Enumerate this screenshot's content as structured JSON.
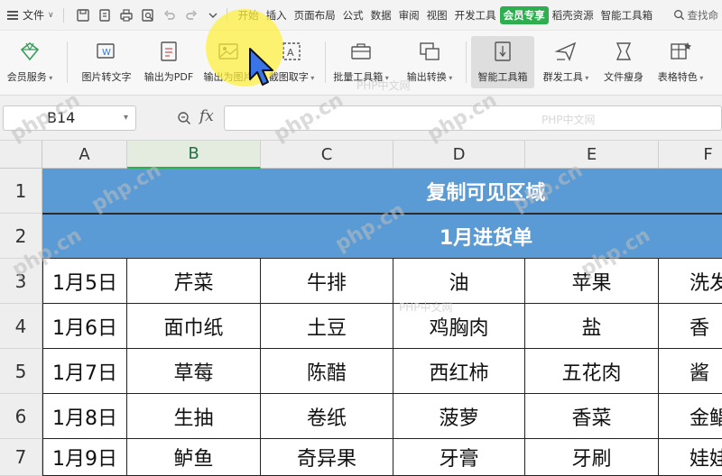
{
  "menubar": {
    "file_label": "文件",
    "tabs": [
      {
        "label": "开始"
      },
      {
        "label": "插入"
      },
      {
        "label": "页面布局"
      },
      {
        "label": "公式"
      },
      {
        "label": "数据"
      },
      {
        "label": "审阅"
      },
      {
        "label": "视图"
      },
      {
        "label": "开发工具"
      },
      {
        "label": "会员专享",
        "active": true
      },
      {
        "label": "稻壳资源"
      },
      {
        "label": "智能工具箱"
      }
    ],
    "search_label": "查找命"
  },
  "ribbon": {
    "buttons": [
      {
        "label": "会员服务",
        "dropdown": true
      },
      {
        "label": "图片转文字"
      },
      {
        "label": "输出为PDF"
      },
      {
        "label": "输出为图片"
      },
      {
        "label": "截图取字",
        "dropdown": true
      },
      {
        "label": "批量工具箱",
        "dropdown": true
      },
      {
        "label": "输出转换",
        "dropdown": true
      },
      {
        "label": "智能工具箱",
        "highlighted": true
      },
      {
        "label": "群发工具",
        "dropdown": true
      },
      {
        "label": "文件瘦身"
      },
      {
        "label": "表格特色",
        "dropdown": true
      }
    ]
  },
  "formula_bar": {
    "cell_ref": "B14",
    "fx_label": "fx",
    "formula": ""
  },
  "sheet": {
    "columns": [
      "A",
      "B",
      "C",
      "D",
      "E",
      "F"
    ],
    "selected_column": "B",
    "rows": [
      "1",
      "2",
      "3",
      "4",
      "5",
      "6",
      "7"
    ],
    "title": "复制可见区域",
    "subtitle": "1月进货单",
    "data": [
      [
        "1月5日",
        "芹菜",
        "牛排",
        "油",
        "苹果",
        "洗发"
      ],
      [
        "1月6日",
        "面巾纸",
        "土豆",
        "鸡胸肉",
        "盐",
        "香"
      ],
      [
        "1月7日",
        "草莓",
        "陈醋",
        "西红柿",
        "五花肉",
        "酱"
      ],
      [
        "1月8日",
        "生抽",
        "卷纸",
        "菠萝",
        "香菜",
        "金鲳"
      ],
      [
        "1月9日",
        "鲈鱼",
        "奇异果",
        "牙膏",
        "牙刷",
        "娃娃"
      ]
    ]
  },
  "colors": {
    "banner_bg": "#5b9bd5",
    "active_tab": "#2eae4e",
    "highlight": "#fff03c"
  },
  "watermarks": {
    "brand": "php.cn",
    "site": "PHP中文网"
  }
}
